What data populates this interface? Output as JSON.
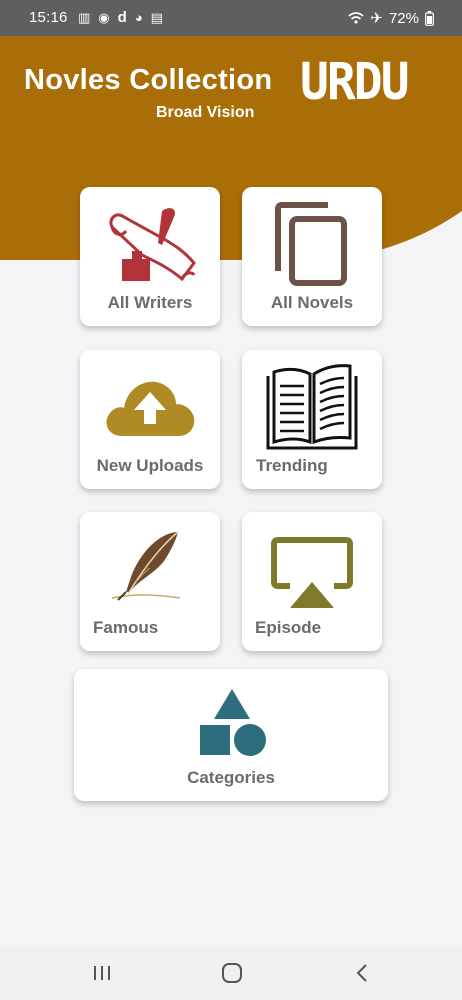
{
  "status_bar": {
    "time": "15:16",
    "battery": "72%"
  },
  "header": {
    "title": "Novles Collection",
    "subtitle": "Broad Vision",
    "urdu_logo": "URDU",
    "color": "#a96e08"
  },
  "menu": {
    "all_writers": "All Writers",
    "all_novels": "All Novels",
    "new_uploads": "New Uploads",
    "trending": "Trending",
    "famous": "Famous",
    "episode": "Episode",
    "categories": "Categories"
  },
  "icons": {
    "all_writers": "scroll-quill-icon",
    "all_novels": "copy-documents-icon",
    "new_uploads": "cloud-upload-icon",
    "trending": "open-book-icon",
    "famous": "feather-quill-icon",
    "episode": "airplay-icon",
    "categories": "shapes-icon"
  },
  "colors": {
    "writers_icon": "#b0343a",
    "novels_icon": "#6d5248",
    "uploads_icon": "#b08a24",
    "episode_icon": "#7e7a2a",
    "categories_icon": "#2d6e7e",
    "label": "#6b6b6b"
  }
}
